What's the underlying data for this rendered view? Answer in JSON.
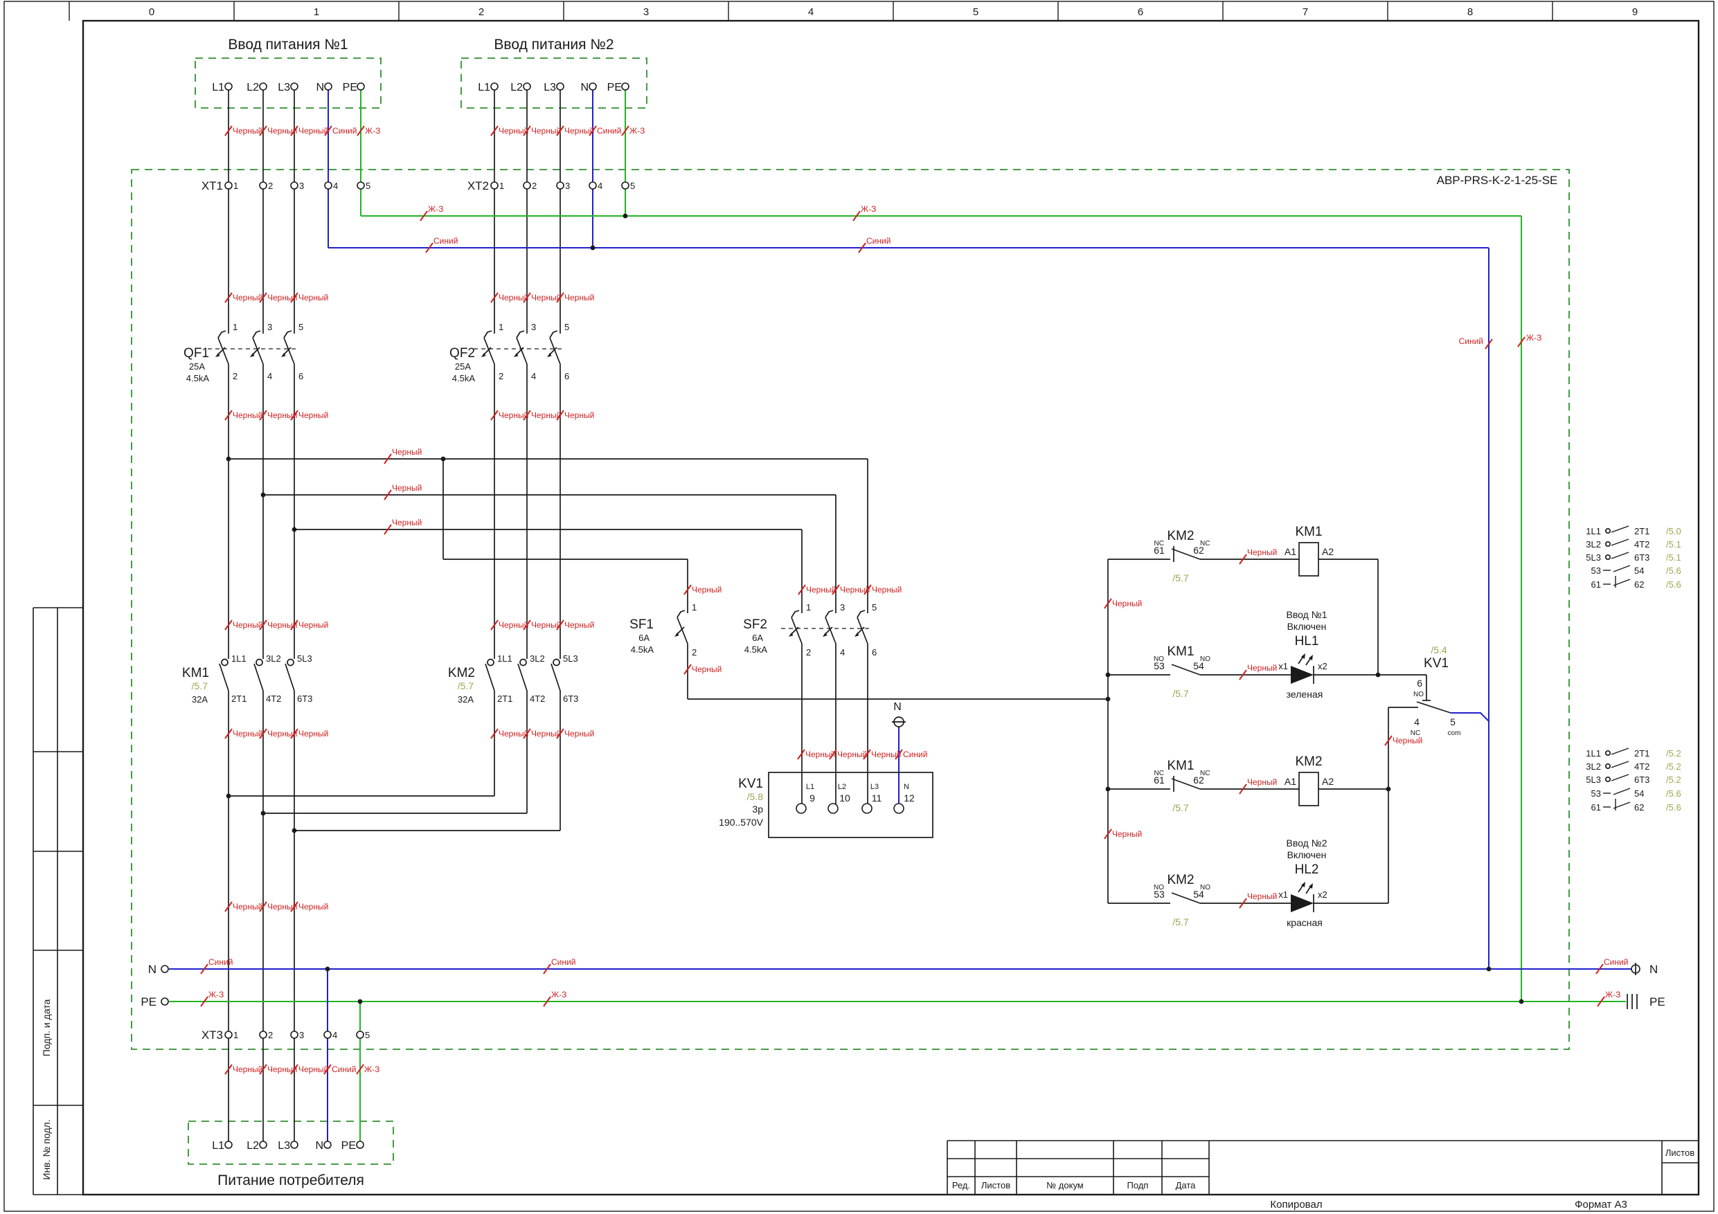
{
  "sheet": {
    "ruler": [
      "0",
      "1",
      "2",
      "3",
      "4",
      "5",
      "6",
      "7",
      "8",
      "9"
    ],
    "stamp": {
      "red": "Ред.",
      "sheets": "Листов",
      "doc": "№ докум",
      "sign": "Подп",
      "date": "Дата",
      "sheets_right": "Листов",
      "copied": "Копировал",
      "format": "Формат А3"
    },
    "side": {
      "sign_date": "Подп. и дата",
      "inv": "Инв. № подл."
    }
  },
  "wire": {
    "black": "Черный",
    "blue": "Синий",
    "pe": "Ж-З"
  },
  "enclosure_name": "АВР-PRS-K-2-1-25-SE",
  "input1": {
    "title": "Ввод питания №1",
    "t": [
      "L1",
      "L2",
      "L3",
      "N",
      "PE"
    ]
  },
  "input2": {
    "title": "Ввод питания №2",
    "t": [
      "L1",
      "L2",
      "L3",
      "N",
      "PE"
    ]
  },
  "load": {
    "title": "Питание потребителя",
    "t": [
      "L1",
      "L2",
      "L3",
      "N",
      "PE"
    ]
  },
  "xt": {
    "xt1": "XT1",
    "xt2": "XT2",
    "xt3": "XT3",
    "n": [
      "1",
      "2",
      "3",
      "4",
      "5"
    ]
  },
  "qf1": {
    "name": "QF1",
    "a": "25A",
    "ka": "4.5kA",
    "top": [
      "1",
      "3",
      "5"
    ],
    "bot": [
      "2",
      "4",
      "6"
    ]
  },
  "qf2": {
    "name": "QF2",
    "a": "25A",
    "ka": "4.5kA",
    "top": [
      "1",
      "3",
      "5"
    ],
    "bot": [
      "2",
      "4",
      "6"
    ]
  },
  "sf1": {
    "name": "SF1",
    "a": "6A",
    "ka": "4.5kA",
    "top": [
      "1"
    ],
    "bot": [
      "2"
    ]
  },
  "sf2": {
    "name": "SF2",
    "a": "6A",
    "ka": "4.5kA",
    "top": [
      "1",
      "3",
      "5"
    ],
    "bot": [
      "2",
      "4",
      "6"
    ]
  },
  "km1": {
    "name": "KM1",
    "ref": "/5.7",
    "a": "32A",
    "top": [
      "1L1",
      "3L2",
      "5L3"
    ],
    "bot": [
      "2T1",
      "4T2",
      "6T3"
    ]
  },
  "km2": {
    "name": "KM2",
    "ref": "/5.7",
    "a": "32A",
    "top": [
      "1L1",
      "3L2",
      "5L3"
    ],
    "bot": [
      "2T1",
      "4T2",
      "6T3"
    ]
  },
  "kv1": {
    "name": "KV1",
    "ref": "/5.8",
    "poles": "3p",
    "range": "190..570V",
    "n_tag": "N",
    "t": [
      {
        "l": "L1",
        "n": "9"
      },
      {
        "l": "L2",
        "n": "10"
      },
      {
        "l": "L3",
        "n": "11"
      },
      {
        "l": "N",
        "n": "12"
      }
    ],
    "contact": {
      "ref": "/5.4",
      "name": "KV1",
      "no_n": "6",
      "no": "NO",
      "nc_n": "4",
      "nc": "NC",
      "com_n": "5",
      "com": "com"
    }
  },
  "ctl": {
    "r1": {
      "name": "KM2",
      "ta": "NC",
      "tb": "NC",
      "a": "61",
      "b": "62",
      "ref": "/5.7"
    },
    "r2": {
      "name": "KM1",
      "ta": "NO",
      "tb": "NO",
      "a": "53",
      "b": "54",
      "ref": "/5.7"
    },
    "r3": {
      "name": "KM1",
      "ta": "NC",
      "tb": "NC",
      "a": "61",
      "b": "62",
      "ref": "/5.7"
    },
    "r4": {
      "name": "KM2",
      "ta": "NO",
      "tb": "NO",
      "a": "53",
      "b": "54",
      "ref": "/5.7"
    },
    "coil1": {
      "name": "KM1",
      "a1": "A1",
      "a2": "A2"
    },
    "coil2": {
      "name": "KM2",
      "a1": "A1",
      "a2": "A2"
    },
    "hl1": {
      "l1": "Ввод №1",
      "l2": "Включен",
      "name": "HL1",
      "x1": "x1",
      "x2": "x2",
      "color": "зеленая"
    },
    "hl2": {
      "l1": "Ввод №2",
      "l2": "Включен",
      "name": "HL2",
      "x1": "x1",
      "x2": "x2",
      "color": "красная"
    }
  },
  "xref1": {
    "rows": [
      {
        "l": "1L1",
        "r": "2T1",
        "ref": "/5.0"
      },
      {
        "l": "3L2",
        "r": "4T2",
        "ref": "/5.1"
      },
      {
        "l": "5L3",
        "r": "6T3",
        "ref": "/5.1"
      },
      {
        "l": "53",
        "r": "54",
        "ref": "/5.6"
      },
      {
        "l": "61",
        "r": "62",
        "ref": "/5.6"
      }
    ]
  },
  "xref2": {
    "rows": [
      {
        "l": "1L1",
        "r": "2T1",
        "ref": "/5.2"
      },
      {
        "l": "3L2",
        "r": "4T2",
        "ref": "/5.2"
      },
      {
        "l": "5L3",
        "r": "6T3",
        "ref": "/5.2"
      },
      {
        "l": "53",
        "r": "54",
        "ref": "/5.6"
      },
      {
        "l": "61",
        "r": "62",
        "ref": "/5.6"
      }
    ]
  },
  "rails": {
    "n": "N",
    "pe": "PE"
  },
  "colors": {
    "wire_black": "#1a1a1a",
    "wire_blue": "#2020cc",
    "wire_green": "#22b522",
    "label_red": "#cc2222",
    "ref_olive": "#9ca64f",
    "box_green": "#2f8f2f"
  }
}
